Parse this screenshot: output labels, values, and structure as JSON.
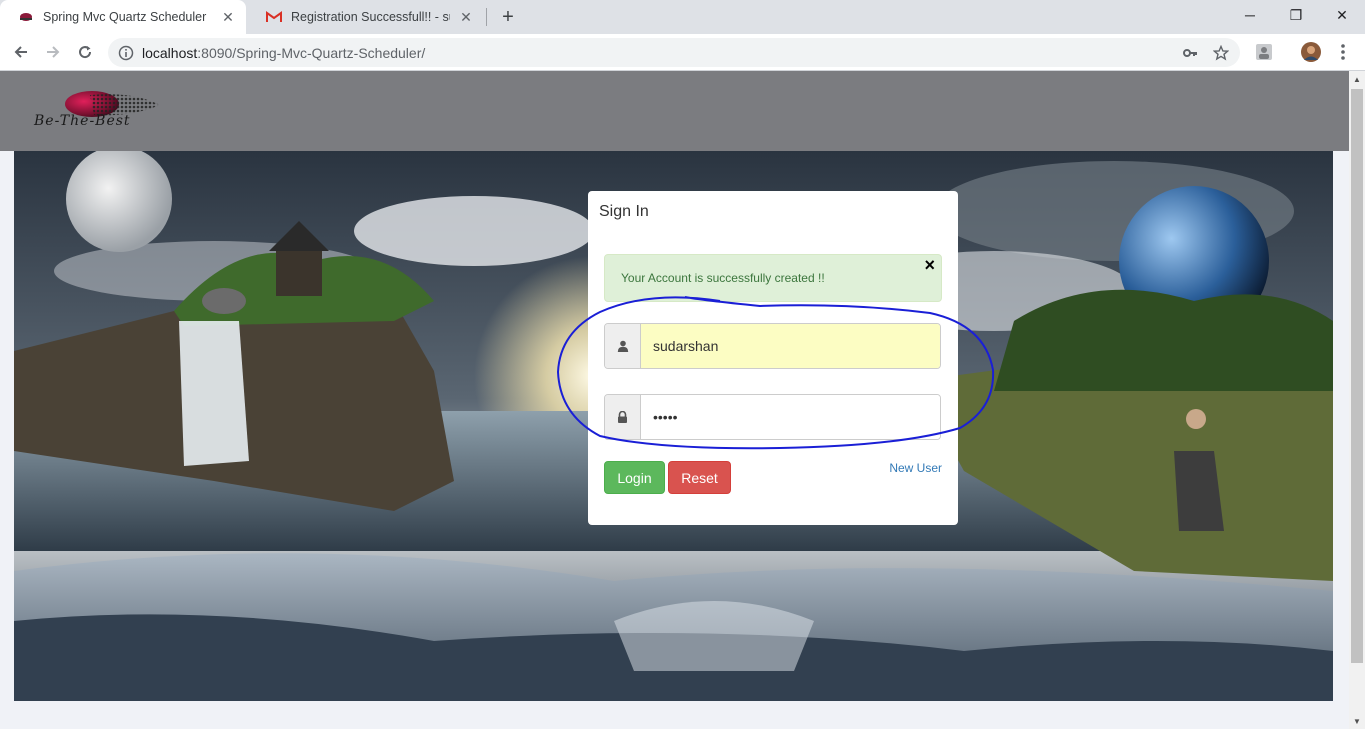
{
  "browser": {
    "tabs": [
      {
        "title": "Spring Mvc Quartz Scheduler",
        "active": true
      },
      {
        "title": "Registration Successfull!! - sudarshan",
        "active": false
      }
    ],
    "url": {
      "host": "localhost",
      "path": ":8090/Spring-Mvc-Quartz-Scheduler/"
    },
    "window_controls": {
      "minimize": "─",
      "restore": "❐",
      "close": "✕"
    }
  },
  "header": {
    "logo_text": "Be-The-Best"
  },
  "carousel": {
    "slides": 4,
    "active_index": 0
  },
  "signin": {
    "title": "Sign In",
    "alert": {
      "message": "Your Account is successfully created !!",
      "close": "×"
    },
    "username": {
      "value": "sudarshan",
      "icon": "user-icon"
    },
    "password": {
      "value": "•••••",
      "icon": "lock-icon"
    },
    "login_label": "Login",
    "reset_label": "Reset",
    "new_user_label": "New User"
  },
  "colors": {
    "success": "#5cb85c",
    "danger": "#d9534f",
    "link": "#337ab7",
    "alert_bg": "#dff0d8",
    "annotation": "#1a1fd6"
  }
}
